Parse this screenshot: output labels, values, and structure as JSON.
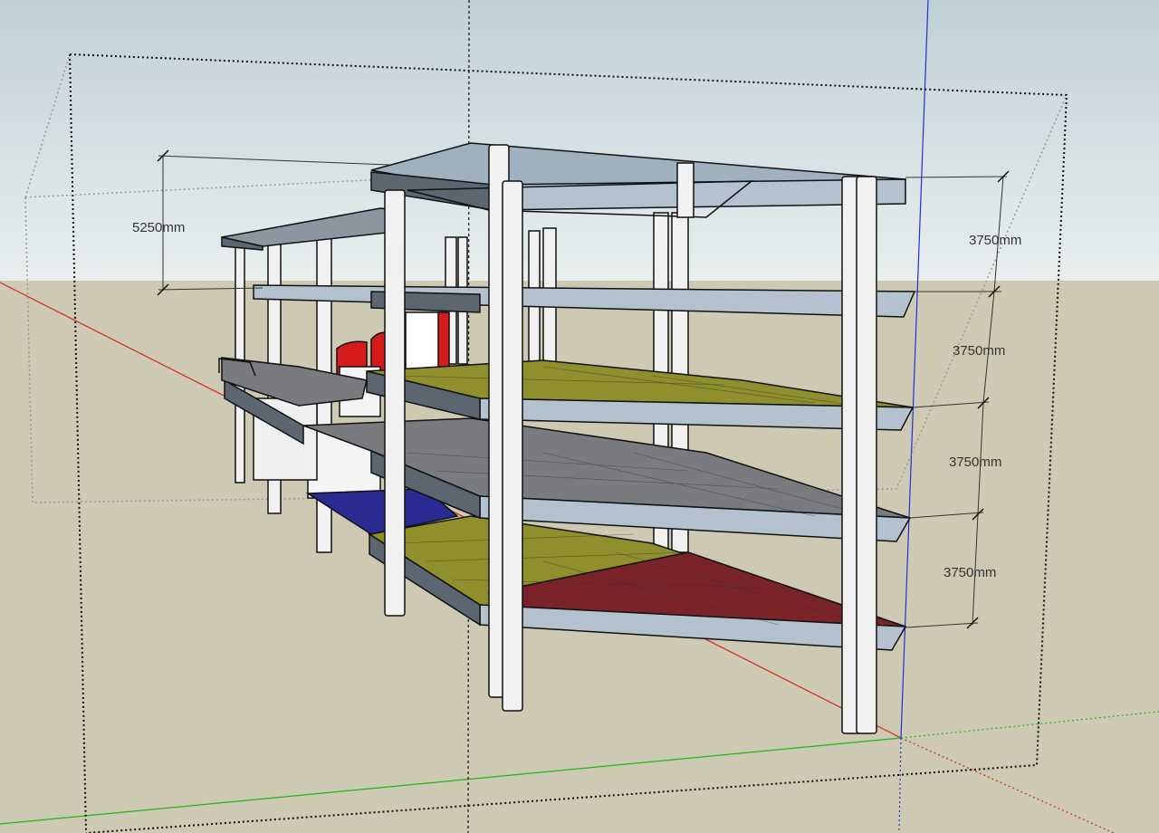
{
  "scene": {
    "sky_color": "#dfe8e8",
    "ground_color": "#cdc9b3",
    "axis_colors": {
      "red": "#d22a20",
      "green": "#22b41e",
      "blue": "#2230d8"
    },
    "floor_colors": {
      "yellow": "#8f8f2d",
      "gray": "#7a7b7e",
      "red": "#7a2328",
      "blue": "#2a2a93",
      "slab_edge": "#b4c2cf",
      "column": "#f1f1f1",
      "wall_red": "#d51b1b"
    }
  },
  "dimensions": {
    "roof_height": "5250mm",
    "floor_1": "3750mm",
    "floor_2": "3750mm",
    "floor_3": "3750mm",
    "floor_4": "3750mm"
  }
}
